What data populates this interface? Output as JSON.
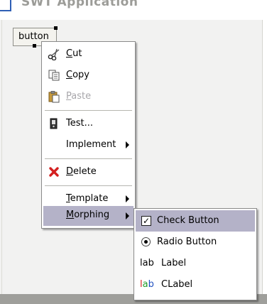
{
  "window": {
    "title": "SWT Application"
  },
  "widget": {
    "label": "button"
  },
  "context_menu": {
    "items": [
      {
        "label": "Cut",
        "mnemonic": "C",
        "rest": "ut",
        "icon": "scissors-icon",
        "enabled": true
      },
      {
        "label": "Copy",
        "mnemonic": "C",
        "rest": "opy",
        "icon": "copy-icon",
        "enabled": true
      },
      {
        "label": "Paste",
        "mnemonic": "P",
        "rest": "aste",
        "icon": "paste-icon",
        "enabled": false
      },
      {
        "label": "Test...",
        "icon": "test-icon",
        "enabled": true
      },
      {
        "label": "Implement",
        "has_submenu": true,
        "enabled": true
      },
      {
        "label": "Delete",
        "mnemonic": "D",
        "rest": "elete",
        "icon": "delete-icon",
        "enabled": true
      },
      {
        "label": "Template",
        "mnemonic": "T",
        "rest": "emplate",
        "has_submenu": true,
        "enabled": true
      },
      {
        "label": "Morphing",
        "mnemonic": "M",
        "rest": "orphing",
        "has_submenu": true,
        "enabled": true,
        "highlighted": true
      }
    ]
  },
  "morphing_submenu": {
    "items": [
      {
        "label": "Check Button",
        "icon": "checkbox-icon",
        "highlighted": true
      },
      {
        "label": "Radio Button",
        "icon": "radio-icon"
      },
      {
        "label": "Label",
        "icon_text": "lab"
      },
      {
        "label": "CLabel",
        "icon_text_parts": [
          "l",
          "a",
          "b"
        ]
      }
    ]
  },
  "colors": {
    "highlight": "#b4b2c8",
    "title_icon": "#2f5fb5",
    "delete_icon": "#d42020"
  }
}
